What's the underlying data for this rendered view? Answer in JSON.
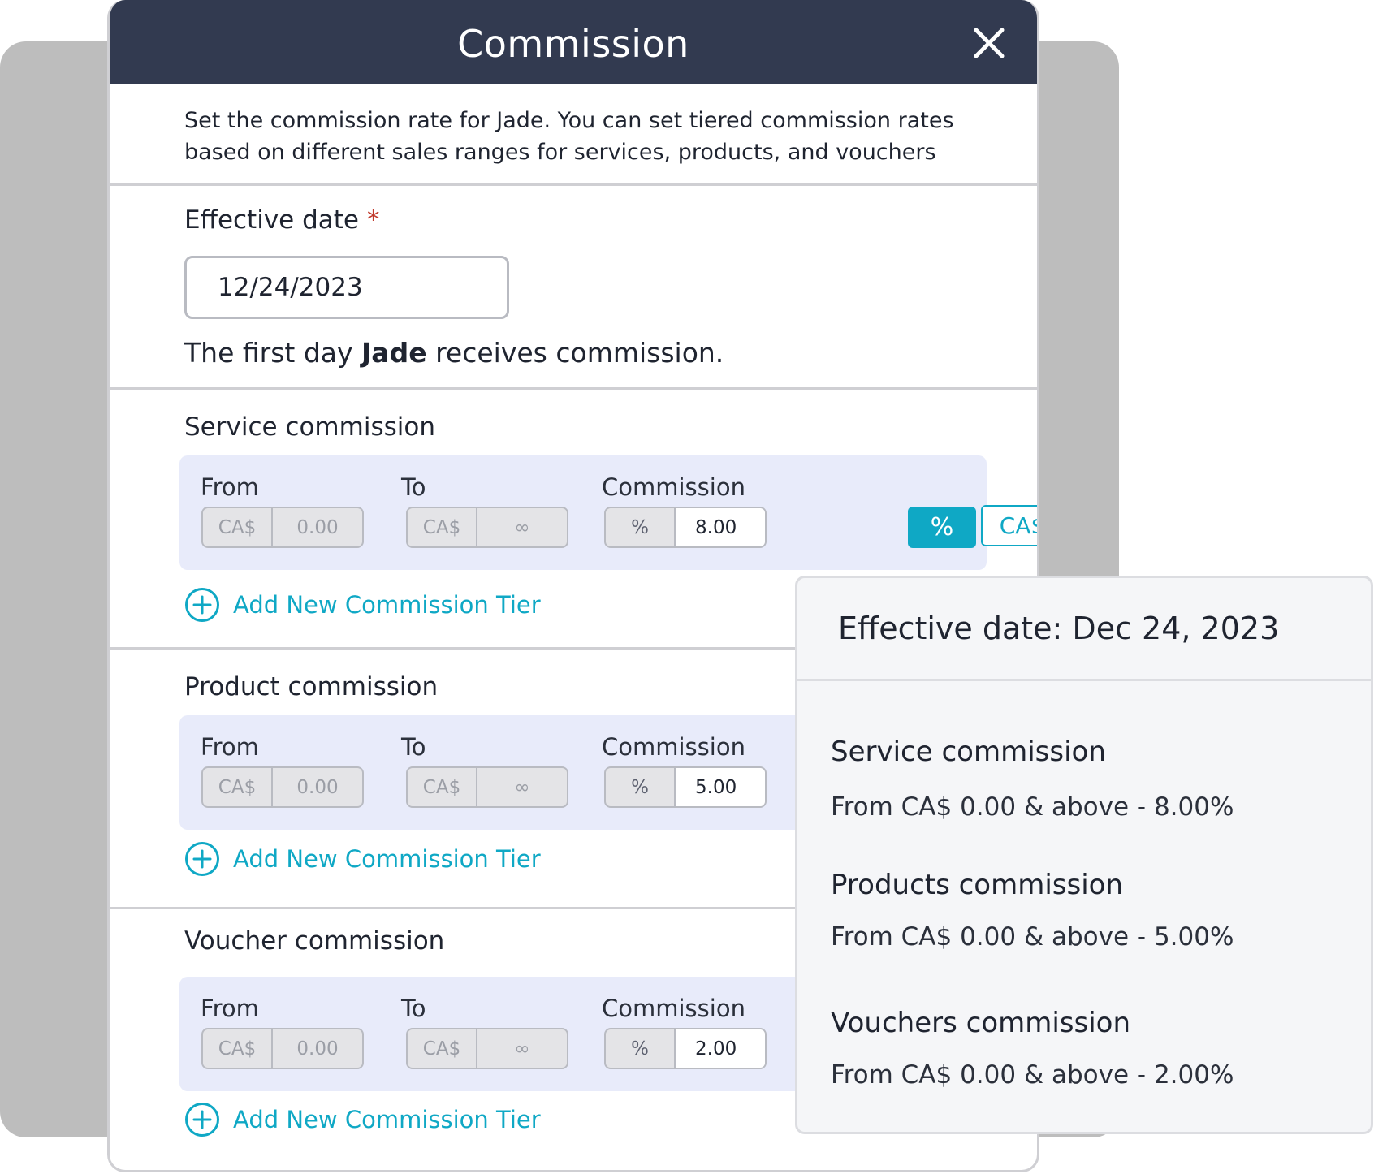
{
  "modal": {
    "title": "Commission",
    "intro": "Set the commission rate for Jade. You can set tiered commission rates based on different sales ranges for services, products, and vouchers"
  },
  "effective_date": {
    "label": "Effective date",
    "required_mark": "*",
    "value": "12/24/2023",
    "help_prefix": "The first day ",
    "help_name": "Jade",
    "help_suffix": " receives commission."
  },
  "columns": {
    "from": "From",
    "to": "To",
    "commission": "Commission"
  },
  "currency": "CA$",
  "percent_symbol": "%",
  "infinity_symbol": "∞",
  "add_tier_label": "Add New Commission Tier",
  "toggle": {
    "percent_label": "%",
    "currency_label": "CA$"
  },
  "sections": [
    {
      "title": "Service commission",
      "from": "0.00",
      "commission": "8.00"
    },
    {
      "title": "Product commission",
      "from": "0.00",
      "commission": "5.00"
    },
    {
      "title": "Voucher commission",
      "from": "0.00",
      "commission": "2.00"
    }
  ],
  "summary": {
    "title": "Effective date: Dec 24, 2023",
    "items": [
      {
        "heading": "Service commission",
        "line": "From CA$ 0.00 & above - 8.00%"
      },
      {
        "heading": "Products commission",
        "line": "From CA$ 0.00 & above - 5.00%"
      },
      {
        "heading": "Vouchers commission",
        "line": "From CA$ 0.00 & above - 2.00%"
      }
    ]
  },
  "colors": {
    "header_bg": "#323a50",
    "accent": "#0fa8c5",
    "tier_panel_bg": "#e8ebfa",
    "required": "#c0392b"
  }
}
